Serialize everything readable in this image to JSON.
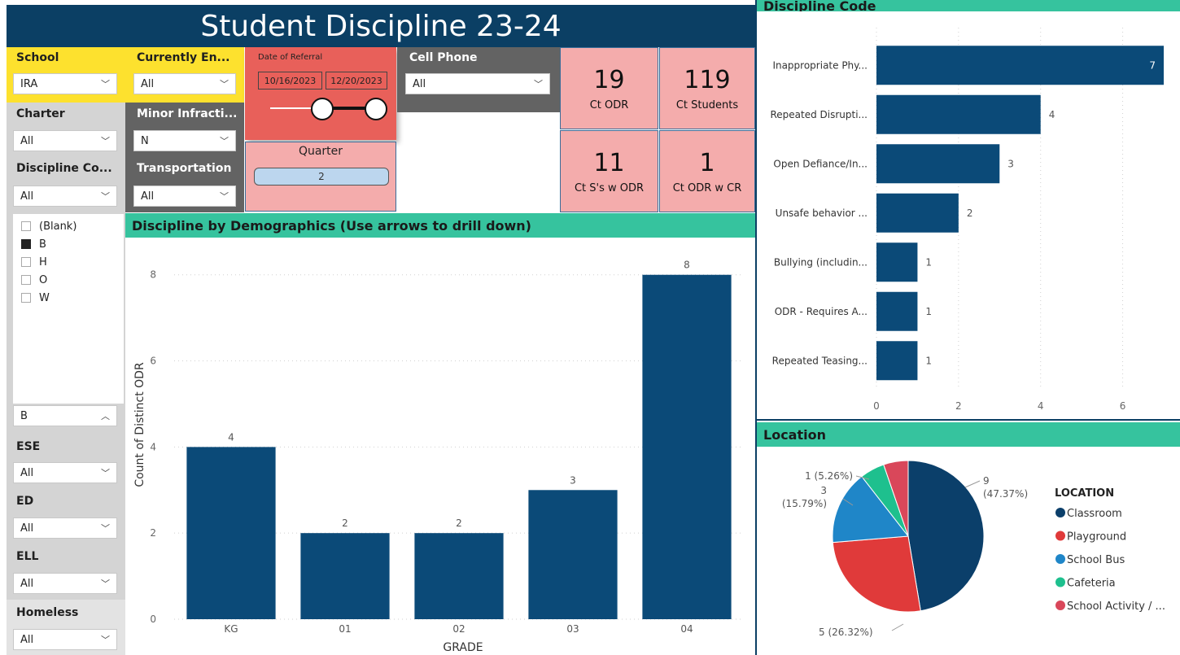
{
  "title": "Student Discipline 23-24",
  "slicers": {
    "school": {
      "label": "School",
      "value": "IRA"
    },
    "currently_enrolled": {
      "label": "Currently En...",
      "value": "All"
    },
    "cell_phone": {
      "label": "Cell Phone",
      "value": "All"
    },
    "charter": {
      "label": "Charter",
      "value": "All"
    },
    "minor_infraction": {
      "label": "Minor Infracti...",
      "value": "N"
    },
    "discipline_code": {
      "label": "Discipline Co...",
      "value": "All"
    },
    "transportation": {
      "label": "Transportation",
      "value": "All"
    },
    "race_list": [
      {
        "label": "(Blank)",
        "checked": false
      },
      {
        "label": "B",
        "checked": true
      },
      {
        "label": "H",
        "checked": false
      },
      {
        "label": "O",
        "checked": false
      },
      {
        "label": "W",
        "checked": false
      }
    ],
    "race_value": "B",
    "ese": {
      "label": "ESE",
      "value": "All"
    },
    "ed": {
      "label": "ED",
      "value": "All"
    },
    "ell": {
      "label": "ELL",
      "value": "All"
    },
    "homeless": {
      "label": "Homeless",
      "value": "All"
    }
  },
  "date_referral": {
    "label": "Date of Referral",
    "start": "10/16/2023",
    "end": "12/20/2023"
  },
  "quarter": {
    "label": "Quarter",
    "value": "2"
  },
  "cards": [
    {
      "value": "19",
      "caption": "Ct ODR"
    },
    {
      "value": "119",
      "caption": "Ct Students"
    },
    {
      "value": "11",
      "caption": "Ct S's w ODR"
    },
    {
      "value": "1",
      "caption": "Ct ODR w CR"
    }
  ],
  "demographics": {
    "header": "Discipline by Demographics (Use arrows to drill down)"
  },
  "discipline_code": {
    "header": "Discipline Code"
  },
  "location": {
    "header": "Location"
  },
  "colors": {
    "navy": "#0b4a78",
    "green": "#36c39e",
    "pink": "#f4acac",
    "red": "#e8605a",
    "gray": "#636363"
  },
  "chart_data": [
    {
      "type": "bar",
      "categories": [
        "KG",
        "01",
        "02",
        "03",
        "04"
      ],
      "values": [
        4,
        2,
        2,
        3,
        8
      ],
      "xlabel": "GRADE",
      "ylabel": "Count of Distinct ODR",
      "yticks": [
        "0",
        "2",
        "4",
        "6",
        "8"
      ],
      "ylim": [
        0,
        8.6
      ],
      "color": "#0b4a78"
    },
    {
      "type": "bar",
      "orientation": "horizontal",
      "categories": [
        "Inappropriate Phy...",
        "Repeated Disrupti...",
        "Open Defiance/In...",
        "Unsafe behavior ...",
        "Bullying (includin...",
        "ODR - Requires A...",
        "Repeated Teasing..."
      ],
      "values": [
        7,
        4,
        3,
        2,
        1,
        1,
        1
      ],
      "xticks": [
        "0",
        "2",
        "4",
        "6"
      ],
      "xlim": [
        0,
        7
      ],
      "color": "#0b4a78"
    },
    {
      "type": "pie",
      "legend_title": "LOCATION",
      "slices": [
        {
          "label": "Classroom",
          "value": 9,
          "text": "9",
          "pct": "(47.37%)",
          "color": "#0b3f6a"
        },
        {
          "label": "Playground",
          "value": 5,
          "text": "5 (26.32%)",
          "color": "#e03a3a"
        },
        {
          "label": "School Bus",
          "value": 3,
          "text": "3",
          "pct": "(15.79%)",
          "color": "#1f86c8"
        },
        {
          "label": "Cafeteria",
          "value": 1,
          "text": "1 (5.26%)",
          "color": "#1ec08e"
        },
        {
          "label": "School Activity / ...",
          "value": 1,
          "text": "",
          "color": "#d9475a"
        }
      ]
    }
  ]
}
